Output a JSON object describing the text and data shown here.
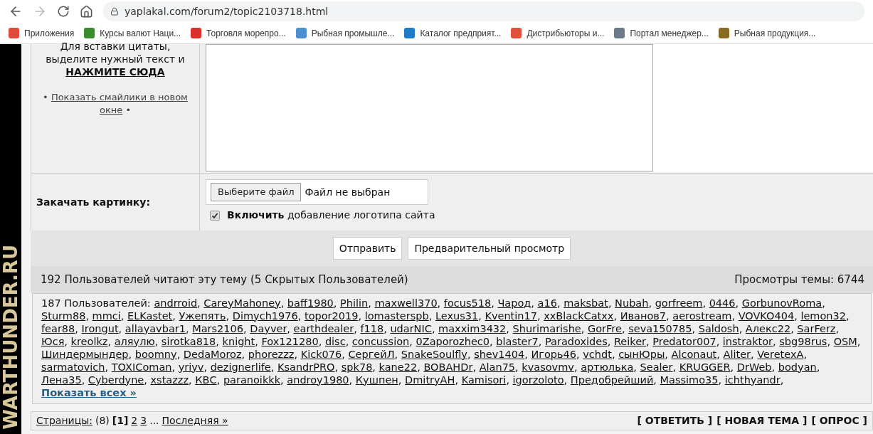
{
  "browser": {
    "url": "yaplakal.com/forum2/topic2103718.html",
    "bookmarks": [
      {
        "label": "Приложения",
        "color": "#e04a3c"
      },
      {
        "label": "Курсы валют Наци...",
        "color": "#3a8a2e"
      },
      {
        "label": "Торговля морепро...",
        "color": "#d9302c"
      },
      {
        "label": "Рыбная промышле...",
        "color": "#4a8fd0"
      },
      {
        "label": "Каталог предприят...",
        "color": "#1f7ac9"
      },
      {
        "label": "Дистрибьюторы и...",
        "color": "#e0503a"
      },
      {
        "label": "Портал менеджер...",
        "color": "#6a7a8a"
      },
      {
        "label": "Рыбная продукция...",
        "color": "#8a6a20"
      }
    ]
  },
  "side_banner": {
    "text": "WARTHUNDER.RU"
  },
  "editor": {
    "hint_lines": [
      "Для вставки цитаты,",
      "выделите нужный текст и"
    ],
    "hint_action": "НАЖМИТЕ СЮДА",
    "smilies_link": "Показать смайлики в новом окне",
    "bullet": "•"
  },
  "upload": {
    "label": "Закачать картинку:",
    "choose_button": "Выберите файл",
    "file_status": "Файл не выбран",
    "logo_checkbox": {
      "bold": "Включить",
      "text": "добавление логотипа сайта",
      "checked": true
    }
  },
  "buttons": [
    "Отправить",
    "Предварительный просмотр"
  ],
  "readers": {
    "title": "192 Пользователей читают эту тему (5 Скрытых Пользователей)",
    "views": "Просмотры темы: 6744",
    "users_prefix": "187 Пользователей:",
    "users": [
      "andrroid",
      "CareyMahoney",
      "baff1980",
      "Philin",
      "maxwell370",
      "focus518",
      "Чарод",
      "a16",
      "maksbat",
      "Nubah",
      "gorfreem",
      "0446",
      "GorbunovRoma",
      "Sturm88",
      "mmci",
      "ELKastet",
      "Ужепять",
      "Dimych1976",
      "topor2019",
      "lomasterspb",
      "Lexus31",
      "Kventin17",
      "xxBlackCatxx",
      "Иванов7",
      "aerostream",
      "VOVKO404",
      "lemon32",
      "fear88",
      "Irongut",
      "allayavbar1",
      "Mars2106",
      "Dayver",
      "earthdealer",
      "f118",
      "udarNIC",
      "maxxim3432",
      "Shurimarishe",
      "GorFre",
      "seva150785",
      "Saldosh",
      "Алекс22",
      "SarFerz",
      "Юся",
      "kreolkz",
      "аляулю",
      "sirotka818",
      "knight",
      "Fox121280",
      "disc",
      "concussion",
      "0Zaporozhec0",
      "blaster7",
      "Paradoxides",
      "Reiker",
      "Predator007",
      "instraktor",
      "sbg98rus",
      "OSM",
      "Шиндермындер",
      "boomny",
      "DedaMoroz",
      "phorezzz",
      "Kick076",
      "СергейЛ",
      "SnakeSoulfly",
      "shev1404",
      "Игорь46",
      "vchdt",
      "сынЮры",
      "Alconaut",
      "Aliter",
      "VeretexA",
      "sarmatovich",
      "TOXIComan",
      "yriyv",
      "dezignerlife",
      "KsandrPRO",
      "spk78",
      "kane22",
      "BOBAHDr",
      "Alan75",
      "kvasovmv",
      "артюлька",
      "Sealer",
      "KRUGGER",
      "DrWeb",
      "bodyan",
      "Лена35",
      "Cyberdyne",
      "xstazzz",
      "КВС",
      "paranoikkk",
      "androy1980",
      "Кушпен",
      "DmitryAH",
      "Kamisori",
      "igorzoloto",
      "Предобрейший",
      "Massimo35",
      "ichthyandr"
    ],
    "separator": ",",
    "show_all": "Показать всех »"
  },
  "pager": {
    "label": "Страницы:",
    "count": "(8)",
    "pages": [
      {
        "label": "[1]",
        "selected": true
      },
      {
        "label": "2",
        "selected": false
      },
      {
        "label": "3",
        "selected": false
      }
    ],
    "ellipsis": "...",
    "last": "Последняя »"
  },
  "actions": [
    "[ ОТВЕТИТЬ ]",
    "[ НОВАЯ ТЕМА ]",
    "[ ОПРОС ]"
  ]
}
